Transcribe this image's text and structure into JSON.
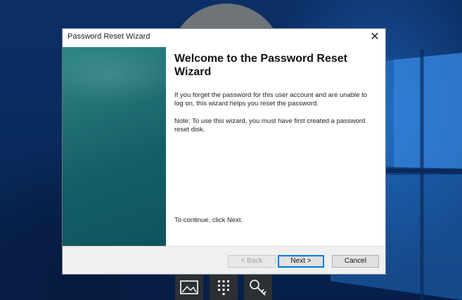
{
  "dialog": {
    "title": "Password Reset Wizard",
    "close_glyph": "✕",
    "heading": "Welcome to the Password Reset Wizard",
    "paragraph1": "If you forget the password for this user account and are unable to log on, this wizard helps you reset the password.",
    "paragraph2": "Note: To use this wizard, you must have first created a password reset disk.",
    "paragraph3": "To continue, click Next.",
    "buttons": {
      "back": "< Back",
      "next": "Next >",
      "cancel": "Cancel"
    }
  },
  "toolbar": {
    "items": [
      {
        "icon": "image-icon"
      },
      {
        "icon": "keypad-icon"
      },
      {
        "icon": "key-icon"
      }
    ]
  },
  "colors": {
    "banner": "#1f6e72",
    "accent": "#0078d7",
    "desktop": "#0a2a5a"
  }
}
